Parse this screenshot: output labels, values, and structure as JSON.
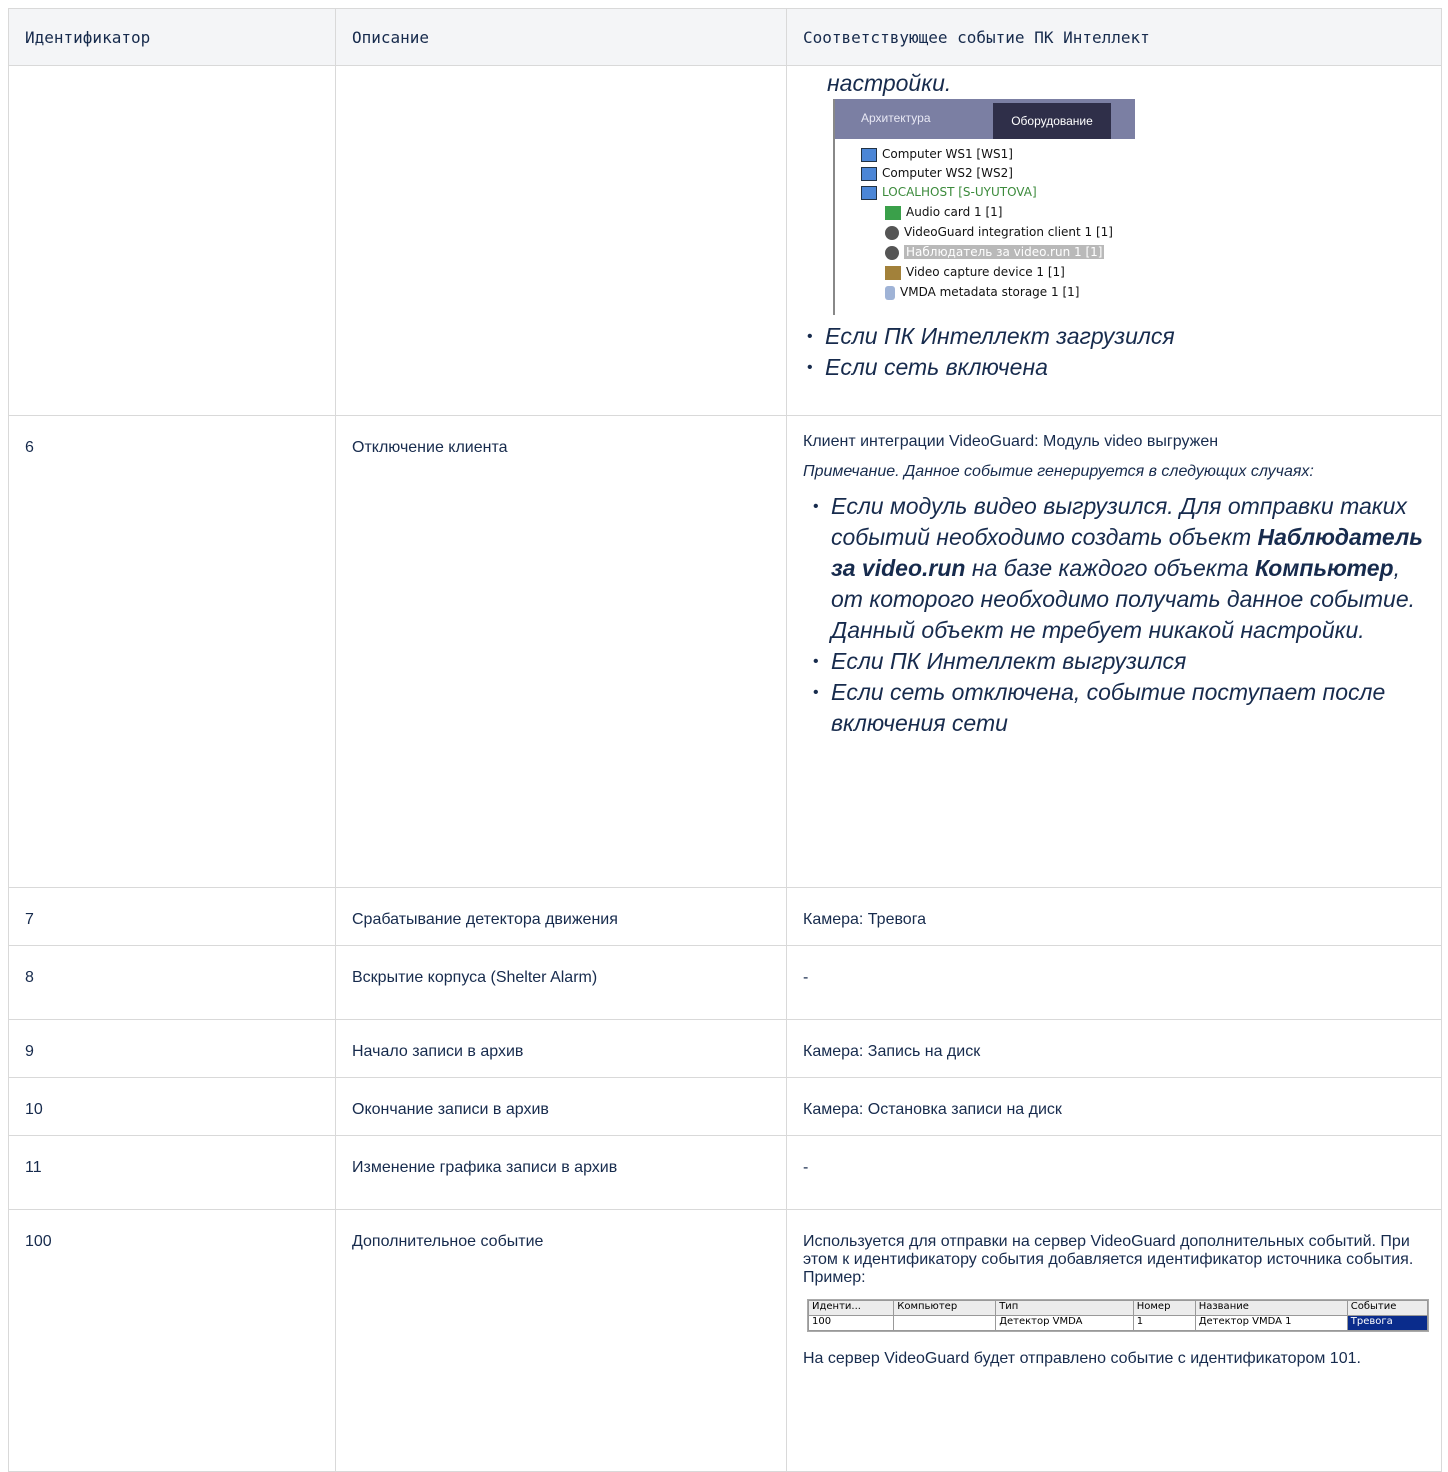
{
  "headers": [
    "Идентификатор",
    "Описание",
    "Соответствующее событие ПК Интеллект"
  ],
  "row_top": {
    "tail_text": "настройки.",
    "screenshot": {
      "tab_architecture": "Архитектура",
      "tab_hardware": "Оборудование",
      "items": [
        "Computer WS1 [WS1]",
        "Computer WS2 [WS2]",
        "LOCALHOST [S-UYUTOVA]",
        "Audio card 1 [1]",
        "VideoGuard integration client 1 [1]",
        "Наблюдатель за video.run 1 [1]",
        "Video capture device 1 [1]",
        "VMDA metadata storage 1 [1]"
      ]
    },
    "bullets": [
      "Если ПК Интеллект загрузился",
      "Если сеть включена"
    ]
  },
  "row6": {
    "id": "6",
    "desc": "Отключение клиента",
    "event": "Клиент интеграции VideoGuard: Модуль video выгружен",
    "note": "Примечание. Данное событие генерируется в следующих случаях:",
    "b1_a": "Если модуль видео выгрузился. Для отправки таких событий необходимо создать объект ",
    "b1_bold1": "Наблюдатель за video.run",
    "b1_b": " на базе каждого объекта ",
    "b1_bold2": "Компьютер",
    "b1_c": ", от которого необходимо получать данное событие. Данный объект не требует никакой настройки.",
    "b2": "Если ПК Интеллект выгрузился",
    "b3": "Если сеть отключена, событие поступает после включения сети"
  },
  "rows": [
    {
      "id": "7",
      "desc": "Срабатывание детектора движения",
      "event": "Камера: Тревога"
    },
    {
      "id": "8",
      "desc": "Вскрытие корпуса (Shelter Alarm)",
      "event": "-"
    },
    {
      "id": "9",
      "desc": "Начало записи в архив",
      "event": "Камера: Запись на диск"
    },
    {
      "id": "10",
      "desc": "Окончание записи в архив",
      "event": "Камера: Остановка записи на диск"
    },
    {
      "id": "11",
      "desc": "Изменение графика записи в архив",
      "event": "-"
    }
  ],
  "row100": {
    "id": "100",
    "desc": "Дополнительное событие",
    "text": "Используется для отправки на сервер VideoGuard дополнительных событий. При этом к идентификатору события добавляется идентификатор источника события. Пример:",
    "mini_headers": [
      "Иденти...",
      "Компьютер",
      "Тип",
      "Номер",
      "Название",
      "Событие"
    ],
    "mini_row": [
      "100",
      "",
      "Детектор VMDA",
      "1",
      "Детектор VMDA 1",
      "Тревога"
    ],
    "after": "На сервер VideoGuard будет отправлено событие с идентификатором 101."
  }
}
